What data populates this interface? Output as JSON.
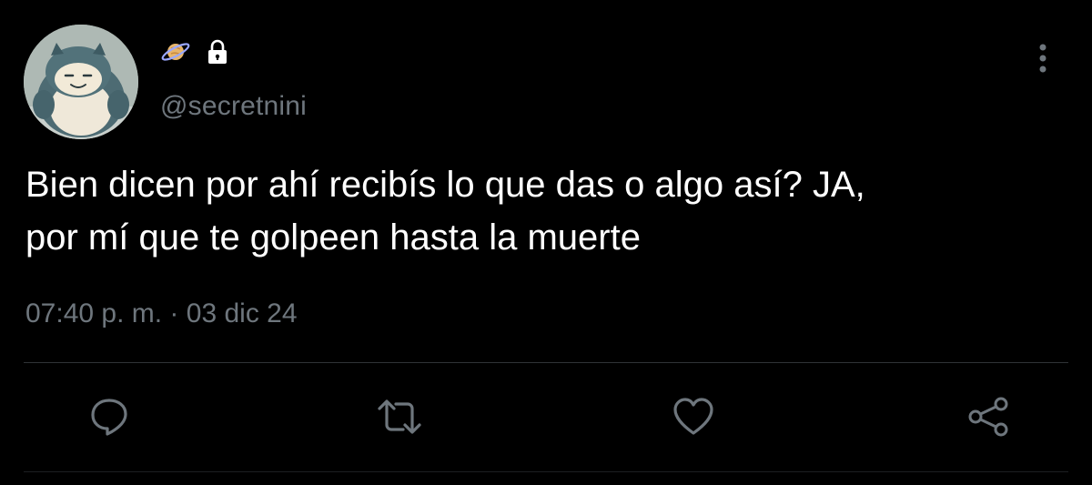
{
  "tweet": {
    "handle": "@secretnini",
    "text": "Bien dicen por ahí recibís lo que das o algo así? JA,\npor mí que te golpeen hasta la muerte",
    "time": "07:40 p. m.",
    "separator": " · ",
    "date": "03 dic 24",
    "display_name_icons": [
      "planet-emoji",
      "lock-icon"
    ]
  },
  "actions": [
    "reply-icon",
    "retweet-icon",
    "like-icon",
    "share-icon"
  ],
  "colors": {
    "background": "#000000",
    "text": "#ffffff",
    "secondary_text": "#6e767d",
    "divider": "#2f3336"
  }
}
